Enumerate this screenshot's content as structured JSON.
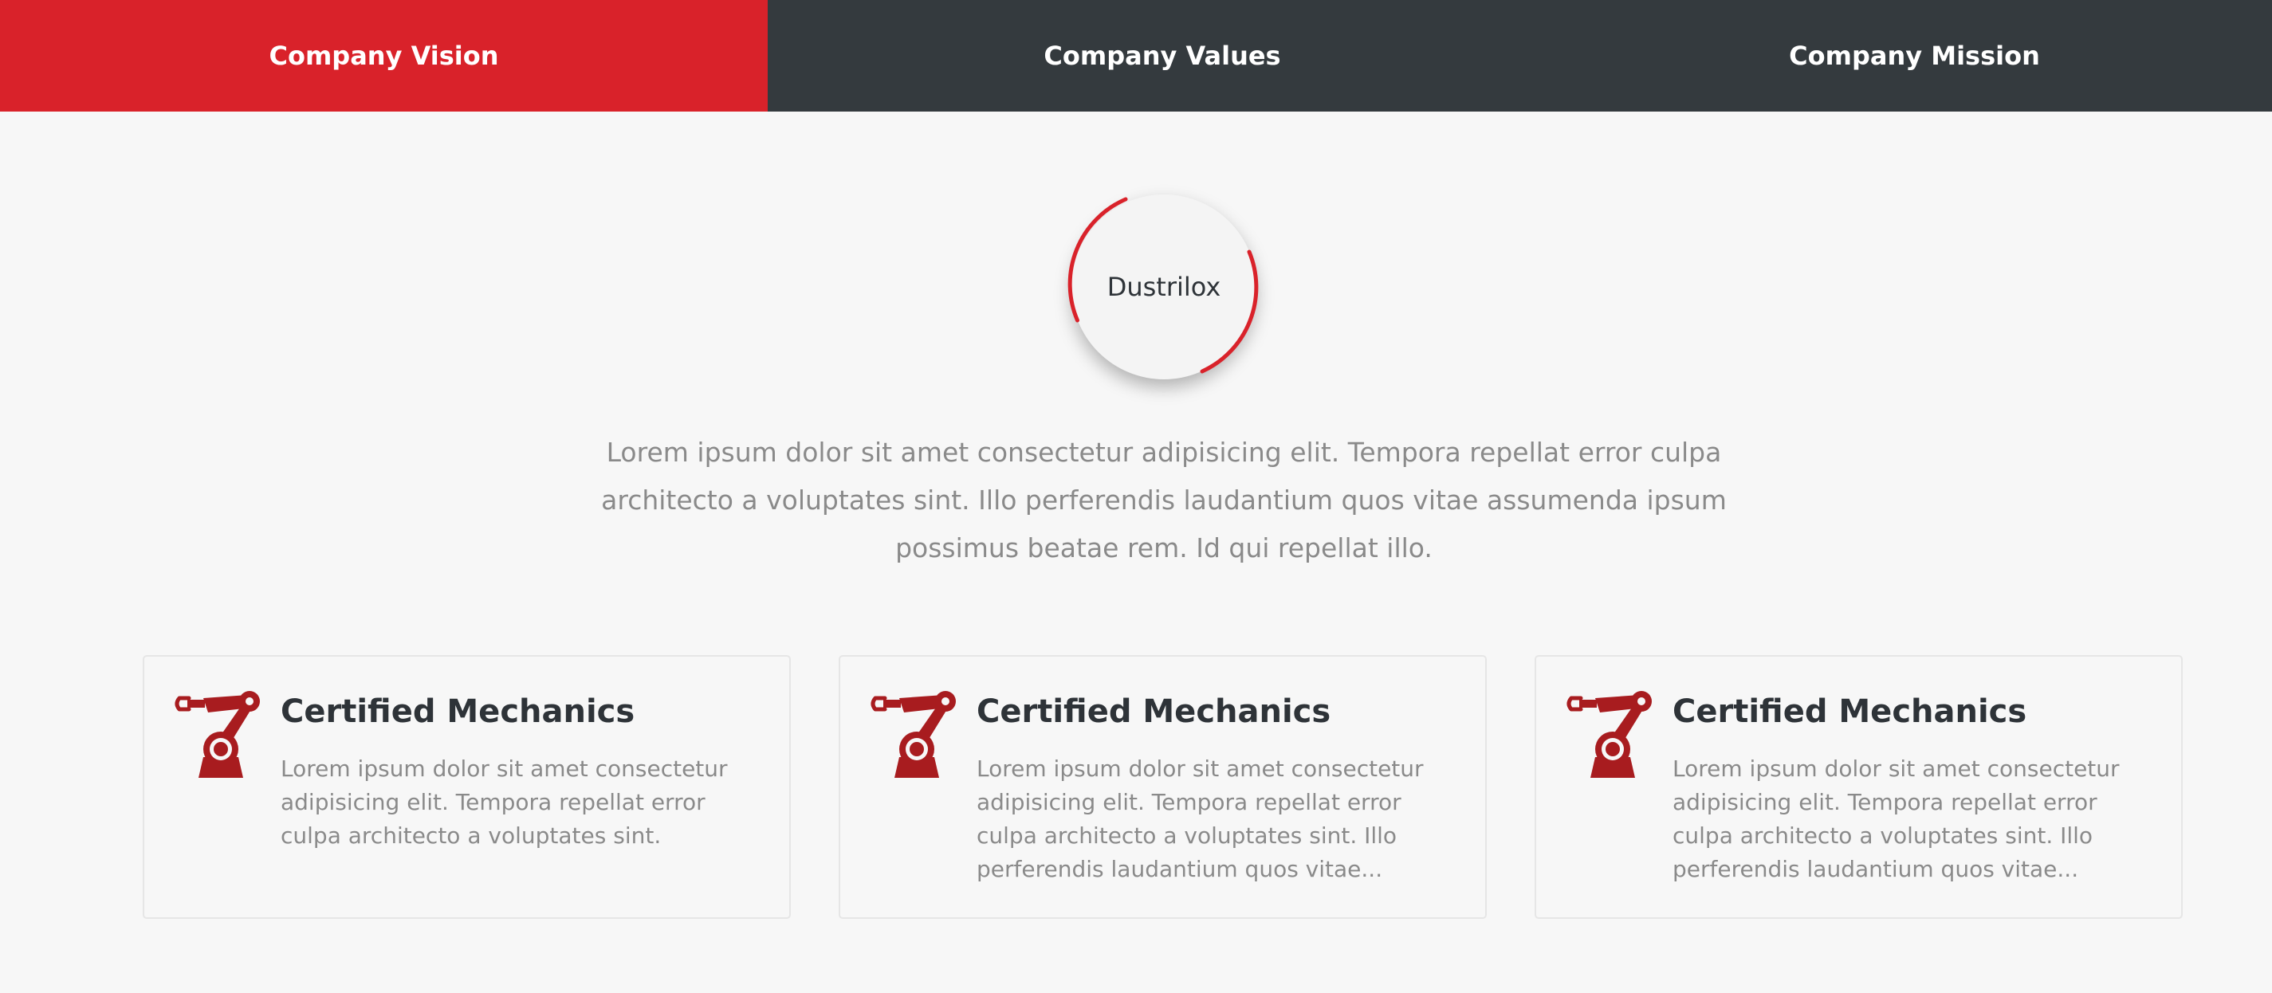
{
  "tabs": [
    {
      "label": "Company Vision",
      "active": true
    },
    {
      "label": "Company Values",
      "active": false
    },
    {
      "label": "Company Mission",
      "active": false
    }
  ],
  "logo": {
    "text": "Dustrilox"
  },
  "intro": {
    "text": "Lorem ipsum dolor sit amet consectetur adipisicing elit. Tempora repellat error culpa architecto a voluptates sint. Illo perferendis laudantium quos vitae assumenda ipsum possimus beatae rem. Id qui repellat illo."
  },
  "cards": [
    {
      "icon": "robot-arm-icon",
      "title": "Certified Mechanics",
      "text": "Lorem ipsum dolor sit amet consectetur adipisicing elit. Tempora repellat error culpa architecto a voluptates sint."
    },
    {
      "icon": "robot-arm-icon",
      "title": "Certified Mechanics",
      "text": "Lorem ipsum dolor sit amet consectetur adipisicing elit. Tempora repellat error culpa architecto a voluptates sint. Illo perferendis laudantium quos vitae..."
    },
    {
      "icon": "robot-arm-icon",
      "title": "Certified Mechanics",
      "text": "Lorem ipsum dolor sit amet consectetur adipisicing elit. Tempora repellat error culpa architecto a voluptates sint. Illo perferendis laudantium quos vitae..."
    }
  ],
  "colors": {
    "accent": "#d9222a",
    "tab_bar": "#343a3e",
    "background": "#f7f7f7",
    "icon": "#a81c1f"
  }
}
